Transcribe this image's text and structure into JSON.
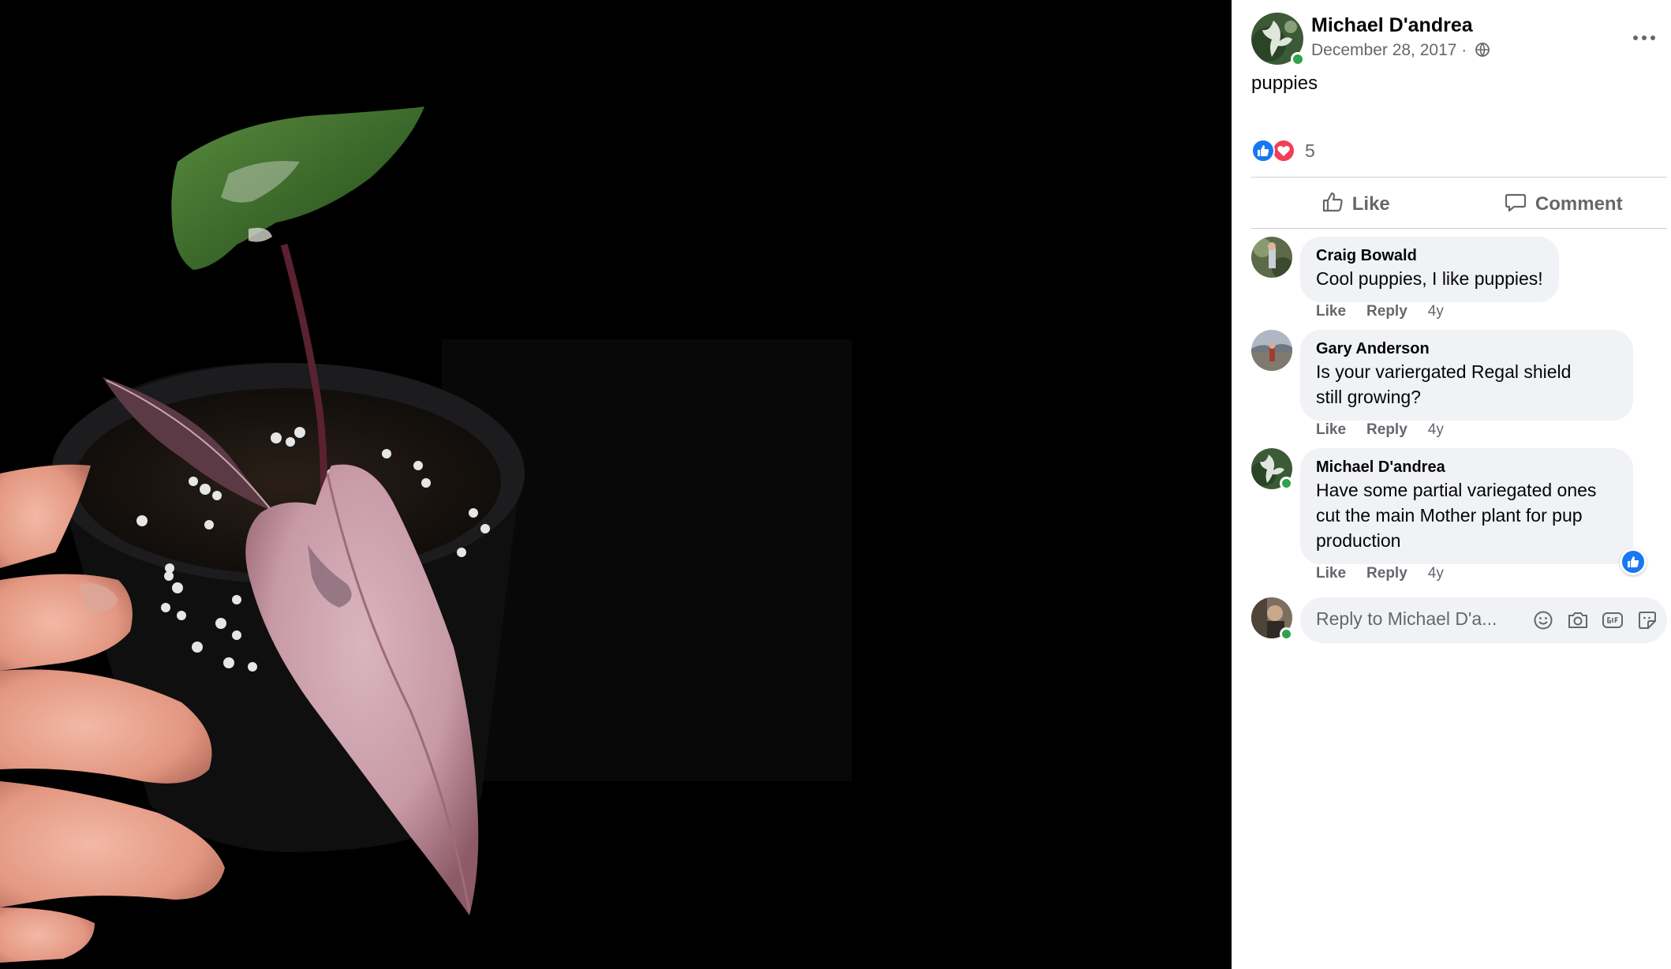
{
  "post": {
    "author": "Michael D'andrea",
    "date": "December 28, 2017",
    "date_separator": "·",
    "privacy_icon": "globe-icon",
    "text": "puppies",
    "reaction_count": "5",
    "reaction_icons": [
      "like-reaction-icon",
      "love-reaction-icon"
    ],
    "more_icon": "more-options-icon"
  },
  "actions": {
    "like_label": "Like",
    "comment_label": "Comment"
  },
  "comments": [
    {
      "author": "Craig Bowald",
      "text": "Cool puppies, I like puppies!",
      "like_label": "Like",
      "reply_label": "Reply",
      "time": "4y"
    },
    {
      "author": "Gary Anderson",
      "text_lines": [
        "Is your variergated Regal shield",
        "still growing?"
      ],
      "like_label": "Like",
      "reply_label": "Reply",
      "time": "4y"
    },
    {
      "author": "Michael D'andrea",
      "text_lines": [
        "Have some partial variegated ones",
        "cut the main Mother plant for pup",
        "production"
      ],
      "like_label": "Like",
      "reply_label": "Reply",
      "time": "4y",
      "reaction_icon": "like-reaction-icon"
    }
  ],
  "reply_box": {
    "placeholder": "Reply to Michael D'a...",
    "tools": [
      "emoji-icon",
      "camera-icon",
      "gif-icon",
      "sticker-icon"
    ]
  },
  "colors": {
    "brand_blue": "#1877f2",
    "love_red": "#f33e58",
    "online_green": "#31a24c",
    "bubble_bg": "#f0f2f5",
    "secondary_text": "#65676b"
  }
}
